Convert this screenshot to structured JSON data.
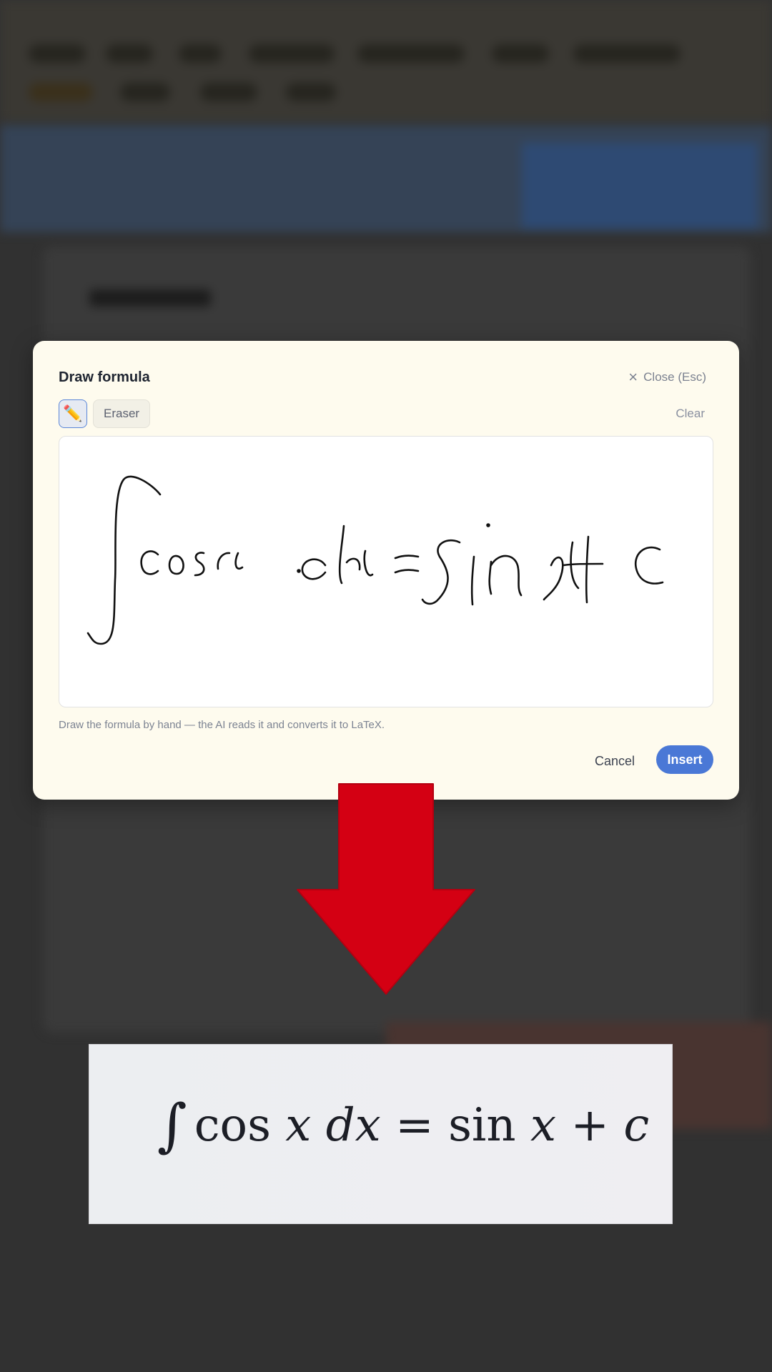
{
  "modal": {
    "title": "Draw formula",
    "close_label": "Close (Esc)",
    "pencil_icon": "✏️",
    "eraser_label": "Eraser",
    "clear_label": "Clear",
    "hint": "Draw the formula by hand — the AI reads it and converts it to LaTeX.",
    "cancel_label": "Cancel",
    "insert_label": "Insert"
  },
  "result": {
    "latex": "\\int \\cos x\\, dx = \\sin x + c",
    "parts": {
      "integral": "∫",
      "cos": "cos",
      "x1": "x",
      "dx": "dx",
      "eq": "=",
      "sin": "sin",
      "x2": "x",
      "plus": "+",
      "c": "c"
    }
  },
  "colors": {
    "overlay": "#313131",
    "modal_bg": "#fefbee",
    "accent": "#4a78d6",
    "arrow": "#d40013"
  }
}
